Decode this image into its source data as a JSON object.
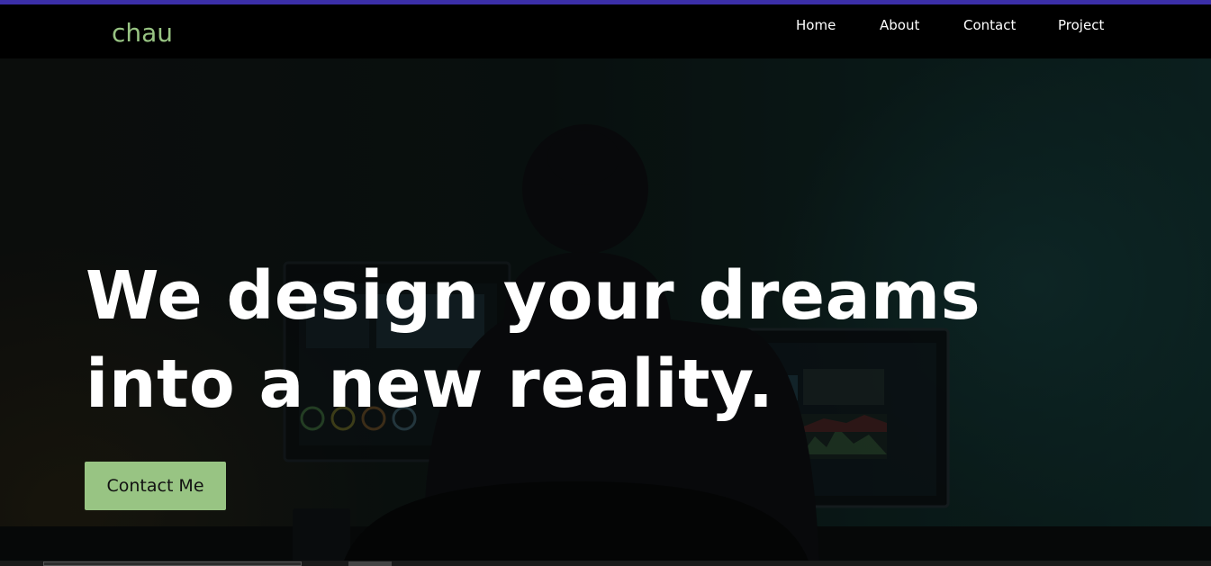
{
  "brand": {
    "name": "chau",
    "color": "#98c483"
  },
  "nav": {
    "items": [
      {
        "label": "Home"
      },
      {
        "label": "About"
      },
      {
        "label": "Contact"
      },
      {
        "label": "Project"
      }
    ]
  },
  "hero": {
    "heading": "We design your dreams into a new reality.",
    "cta_label": "Contact Me",
    "cta_color": "#98c483"
  },
  "colors": {
    "accent_bar": "#3b2fa8",
    "navbar_bg": "#000000"
  }
}
